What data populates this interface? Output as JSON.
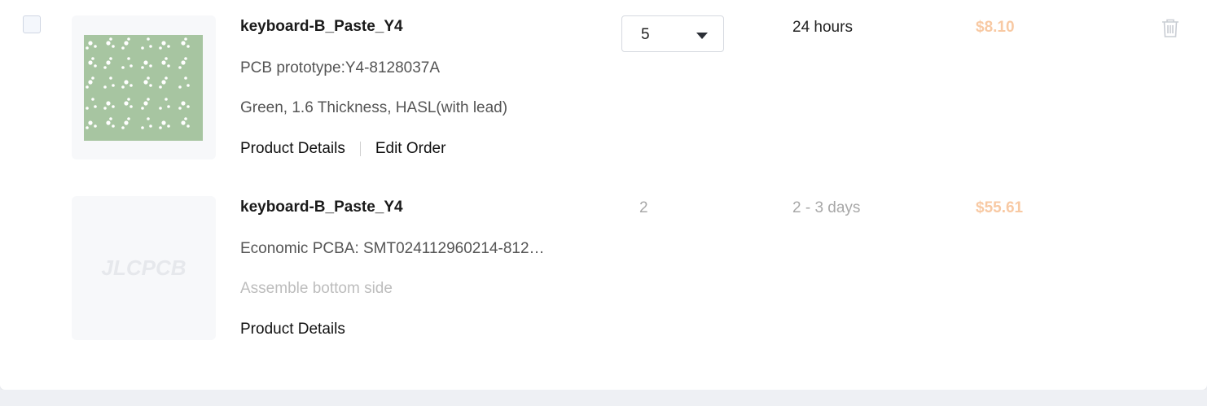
{
  "items": [
    {
      "name": "keyboard-B_Paste_Y4",
      "line1": "PCB prototype:Y4-8128037A",
      "line2": "Green, 1.6 Thickness, HASL(with lead)",
      "links": [
        "Product Details",
        "Edit Order"
      ],
      "quantity": "5",
      "lead_time": "24 hours",
      "price": "$8.10",
      "thumbnail": "green-pcb-image"
    },
    {
      "name": "keyboard-B_Paste_Y4",
      "line1": "Economic PCBA: SMT024112960214-812…",
      "line2": "Assemble bottom side",
      "links": [
        "Product Details"
      ],
      "quantity": "2",
      "lead_time": "2 - 3 days",
      "price": "$55.61",
      "thumbnail_text": "JLCPCB"
    }
  ],
  "colors": {
    "price": "#f8c9a3",
    "pcb_green": "#a7c5a1",
    "muted_text": "#bdbdbd"
  },
  "icons": [
    "trash-icon",
    "chevron-down-icon"
  ]
}
